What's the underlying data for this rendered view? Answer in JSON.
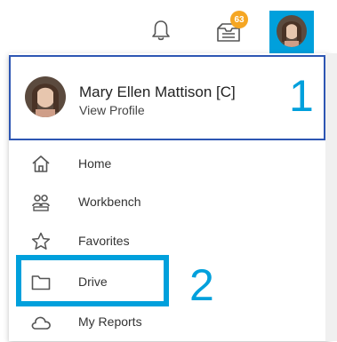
{
  "header": {
    "notifications_icon": "bell-icon",
    "inbox_icon": "inbox-icon",
    "inbox_badge": "63",
    "avatar": "user-avatar",
    "colors": {
      "badge": "#f5a623",
      "highlight": "#00a0dc",
      "profile_border": "#2d56b3"
    }
  },
  "profile": {
    "name": "Mary Ellen Mattison [C]",
    "link": "View Profile"
  },
  "annotations": {
    "step1": "1",
    "step2": "2"
  },
  "menu": {
    "items": [
      {
        "label": "Home",
        "icon": "home-icon"
      },
      {
        "label": "Workbench",
        "icon": "workbench-icon"
      },
      {
        "label": "Favorites",
        "icon": "star-icon"
      },
      {
        "label": "Drive",
        "icon": "folder-icon"
      },
      {
        "label": "My Reports",
        "icon": "cloud-icon"
      }
    ]
  }
}
